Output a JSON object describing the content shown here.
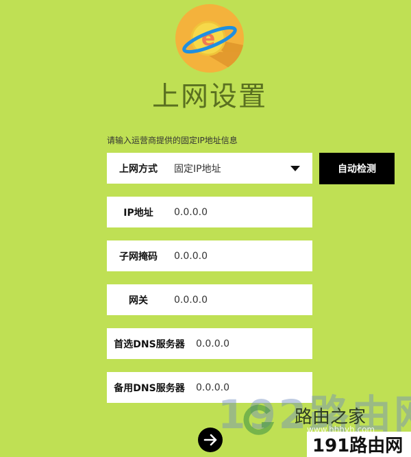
{
  "page": {
    "title": "上网设置",
    "hint": "请输入运营商提供的固定IP地址信息"
  },
  "form": {
    "mode": {
      "label": "上网方式",
      "value": "固定IP地址"
    },
    "detect_button": "自动检测",
    "ip": {
      "label": "IP地址",
      "value": "0.0.0.0"
    },
    "mask": {
      "label": "子网掩码",
      "value": "0.0.0.0"
    },
    "gateway": {
      "label": "网关",
      "value": "0.0.0.0"
    },
    "dns1": {
      "label": "首选DNS服务器",
      "value": "0.0.0.0"
    },
    "dns2": {
      "label": "备用DNS服务器",
      "value": "0.0.0.0"
    }
  },
  "icons": {
    "logo": "internet-globe-icon",
    "next": "arrow-right-icon",
    "dropdown": "caret-down-icon"
  },
  "watermark": {
    "big": "192路由网",
    "site": "路由之家",
    "url": "www.hhhyh.com",
    "bottom": "191路由网"
  },
  "colors": {
    "background": "#bfe054",
    "title": "#5a7020",
    "button": "#000000"
  }
}
